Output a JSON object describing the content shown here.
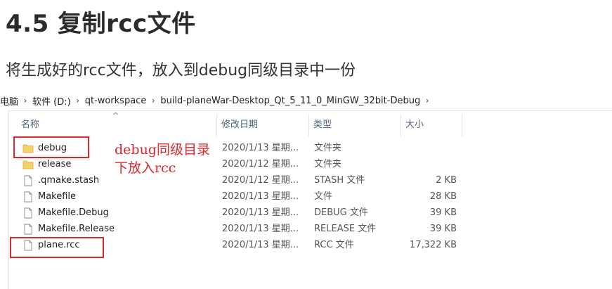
{
  "heading": "4.5 复制rcc文件",
  "instruction": "将生成好的rcc文件，放入到debug同级目录中一份",
  "breadcrumb": [
    "电脑",
    "软件 (D:)",
    "qt-workspace",
    "build-planeWar-Desktop_Qt_5_11_0_MinGW_32bit-Debug"
  ],
  "columns": {
    "name": "名称",
    "date": "修改日期",
    "type": "类型",
    "size": "大小"
  },
  "files": [
    {
      "name": "debug",
      "date": "2020/1/13 星期...",
      "type": "文件夹",
      "size": "",
      "icon": "folder-icon"
    },
    {
      "name": "release",
      "date": "2020/1/12 星期...",
      "type": "文件夹",
      "size": "",
      "icon": "folder-icon"
    },
    {
      "name": ".qmake.stash",
      "date": "2020/1/12 星期...",
      "type": "STASH 文件",
      "size": "2 KB",
      "icon": "file-icon"
    },
    {
      "name": "Makefile",
      "date": "2020/1/13 星期...",
      "type": "文件",
      "size": "28 KB",
      "icon": "file-icon"
    },
    {
      "name": "Makefile.Debug",
      "date": "2020/1/13 星期...",
      "type": "DEBUG 文件",
      "size": "39 KB",
      "icon": "file-icon"
    },
    {
      "name": "Makefile.Release",
      "date": "2020/1/13 星期...",
      "type": "RELEASE 文件",
      "size": "39 KB",
      "icon": "file-icon"
    },
    {
      "name": "plane.rcc",
      "date": "2020/1/13 星期...",
      "type": "RCC 文件",
      "size": "17,322 KB",
      "icon": "file-icon"
    }
  ],
  "annotation": {
    "line1": "debug同级目录",
    "line2": "下放入rcc",
    "color": "#e0262d"
  },
  "colors": {
    "folder": "#f7d068",
    "header_text": "#4c607a",
    "annotation_red": "#e0262d"
  }
}
